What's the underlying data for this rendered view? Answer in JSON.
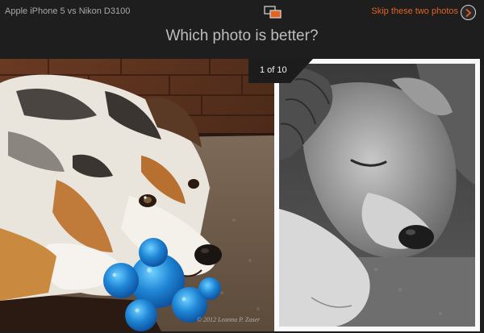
{
  "header": {
    "comparison_title": "Apple iPhone 5 vs Nikon D3100",
    "skip_label": "Skip these two photos",
    "swap_icon": "swap-photos-icon",
    "skip_icon": "chevron-right-icon"
  },
  "headline": "Which photo is better?",
  "counter": "1 of 10",
  "photos": {
    "left": {
      "subject": "dog-photo-color"
    },
    "right": {
      "subject": "dog-photo-black-and-white"
    }
  },
  "watermark": "© 2012 Leanna P. Zaser",
  "colors": {
    "accent": "#e2631f",
    "background": "#1e1e1e"
  }
}
